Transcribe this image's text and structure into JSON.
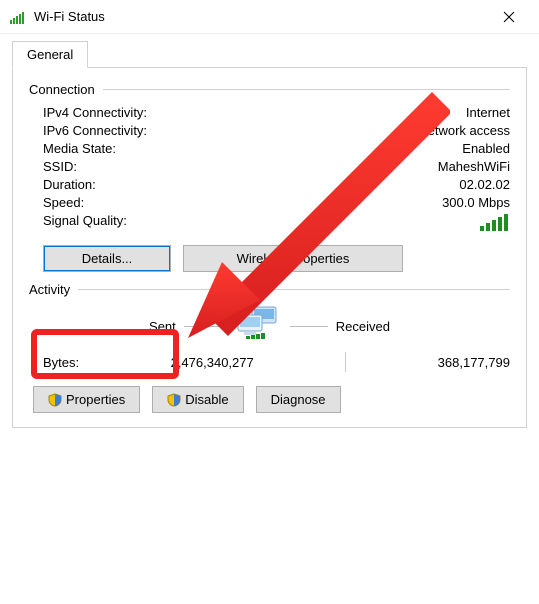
{
  "window": {
    "title": "Wi-Fi Status"
  },
  "tabs": {
    "general": "General"
  },
  "connection": {
    "header": "Connection",
    "ipv4_label": "IPv4 Connectivity:",
    "ipv4_value": "Internet",
    "ipv6_label": "IPv6 Connectivity:",
    "ipv6_value": "No network access",
    "media_label": "Media State:",
    "media_value": "Enabled",
    "ssid_label": "SSID:",
    "ssid_value": "MaheshWiFi",
    "duration_label": "Duration:",
    "duration_value": "02.02.02",
    "speed_label": "Speed:",
    "speed_value": "300.0 Mbps",
    "signal_label": "Signal Quality:"
  },
  "buttons": {
    "details": "Details...",
    "wireless_props": "Wireless Properties"
  },
  "activity": {
    "header": "Activity",
    "sent_label": "Sent",
    "received_label": "Received",
    "bytes_label": "Bytes:",
    "bytes_sent": "2,476,340,277",
    "bytes_received": "368,177,799"
  },
  "bottom": {
    "properties": "Properties",
    "disable": "Disable",
    "diagnose": "Diagnose"
  }
}
